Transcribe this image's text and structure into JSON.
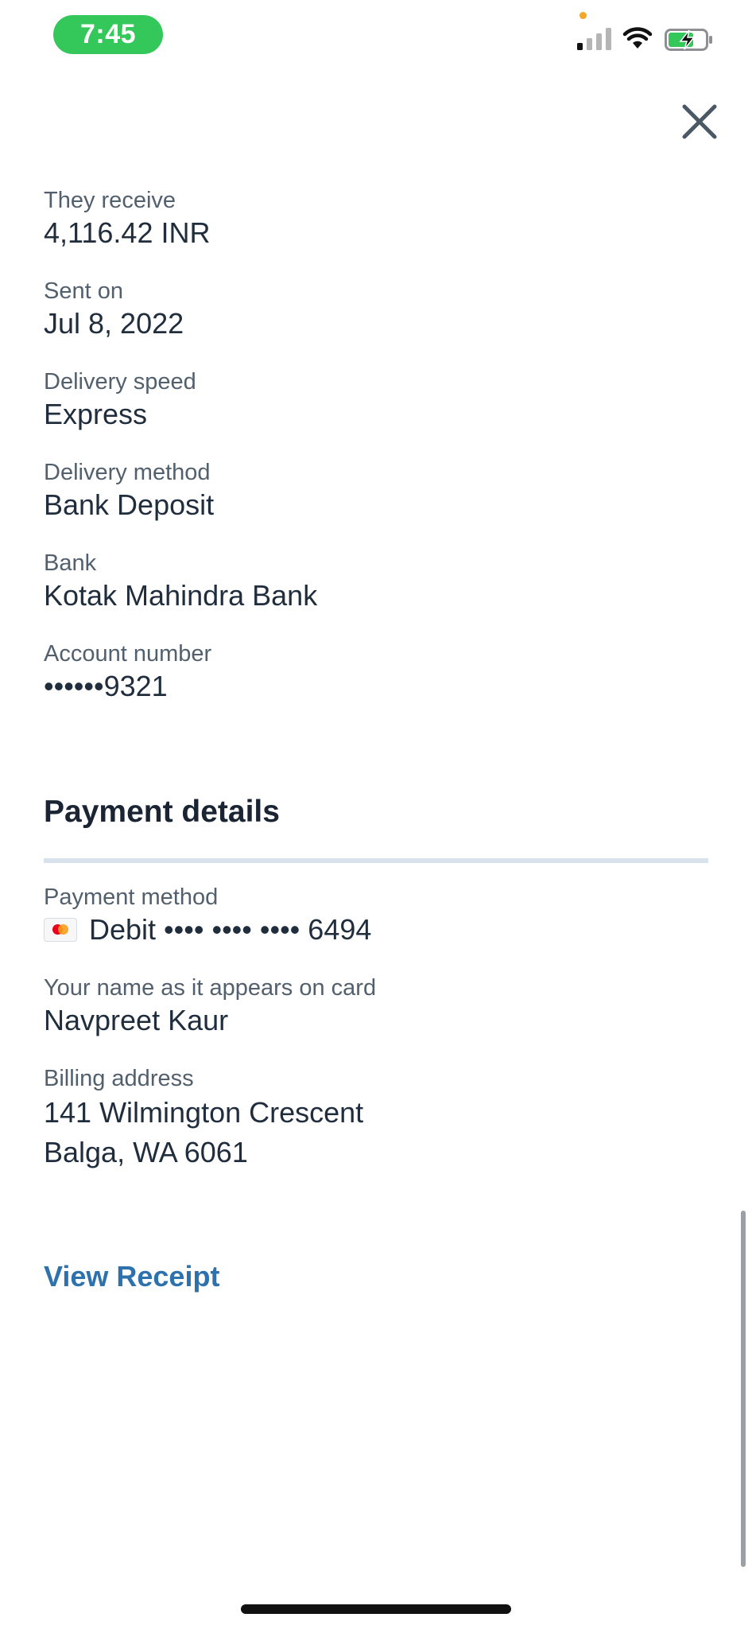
{
  "status_bar": {
    "time": "7:45",
    "icons": [
      "signal-icon",
      "wifi-icon",
      "battery-charging-icon"
    ],
    "time_pill_color": "#34c759",
    "privacy_dot_color": "#f5a623"
  },
  "header": {
    "close_icon": "close-icon"
  },
  "transfer_details": [
    {
      "label": "They receive",
      "value": "4,116.42 INR"
    },
    {
      "label": "Sent on",
      "value": "Jul 8, 2022"
    },
    {
      "label": "Delivery speed",
      "value": "Express"
    },
    {
      "label": "Delivery method",
      "value": "Bank Deposit"
    },
    {
      "label": "Bank",
      "value": "Kotak Mahindra Bank"
    },
    {
      "label": "Account number",
      "value": "••••••9321"
    }
  ],
  "payment_details": {
    "title": "Payment details",
    "method_label": "Payment method",
    "method_value": "Debit •••• •••• •••• 6494",
    "card_icon": "mastercard-icon",
    "name_label": "Your name as it appears on card",
    "name_value": "Navpreet Kaur",
    "billing_label": "Billing address",
    "billing_line1": "141 Wilmington Crescent",
    "billing_line2": "Balga, WA  6061"
  },
  "actions": {
    "view_receipt": "View Receipt",
    "link_color": "#2d72ad"
  }
}
